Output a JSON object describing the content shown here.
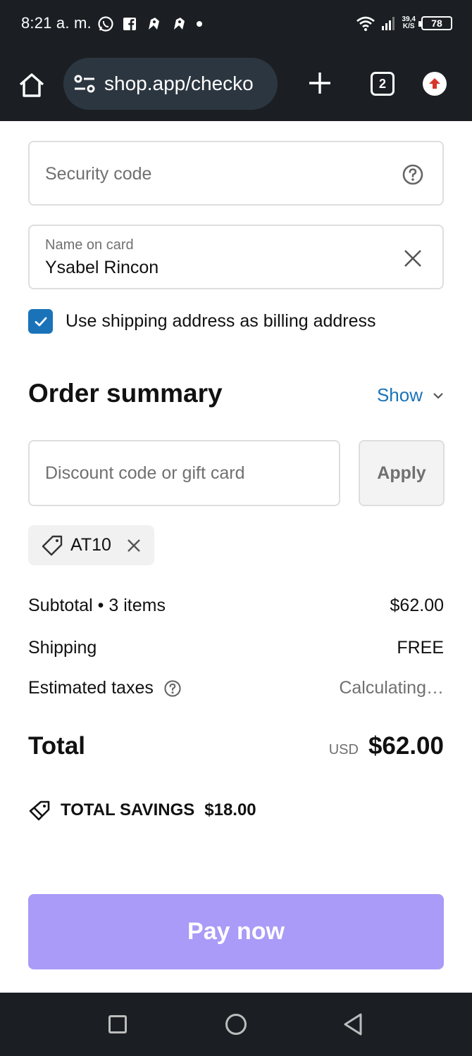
{
  "status_bar": {
    "time": "8:21 a. m.",
    "net_speed_value": "39,4",
    "net_speed_unit": "K/S",
    "battery": "78"
  },
  "browser": {
    "url": "shop.app/checko",
    "tab_count": "2"
  },
  "form": {
    "security_code_placeholder": "Security code",
    "name_label": "Name on card",
    "name_value": "Ysabel Rincon",
    "billing_checkbox_label": "Use shipping address as billing address",
    "billing_checked": true
  },
  "summary": {
    "title": "Order summary",
    "show_label": "Show",
    "discount_placeholder": "Discount code or gift card",
    "apply_label": "Apply",
    "applied_code": "AT10",
    "subtotal_label": "Subtotal • 3 items",
    "subtotal_value": "$62.00",
    "shipping_label": "Shipping",
    "shipping_value": "FREE",
    "taxes_label": "Estimated taxes",
    "taxes_value": "Calculating…",
    "total_label": "Total",
    "currency": "USD",
    "total_value": "$62.00",
    "savings_label": "TOTAL SAVINGS",
    "savings_value": "$18.00"
  },
  "actions": {
    "pay_label": "Pay now"
  },
  "colors": {
    "accent": "#1a73b8",
    "pay_button": "#a99bf7",
    "chrome_dark": "#1b1f23"
  }
}
